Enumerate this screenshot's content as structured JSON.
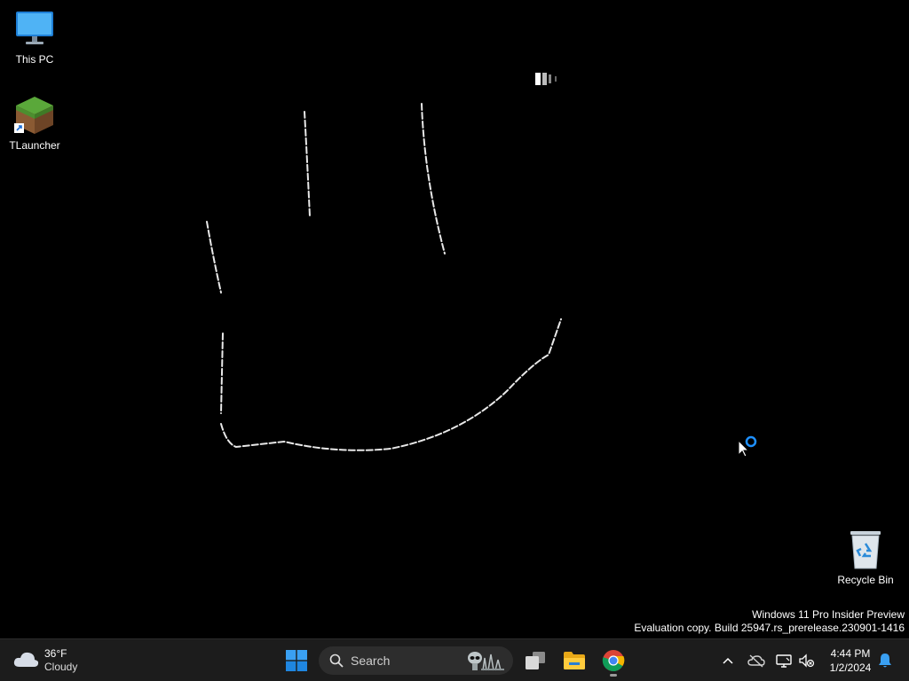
{
  "desktop": {
    "icons": [
      {
        "label": "This PC",
        "icon": "monitor-icon"
      },
      {
        "label": "TLauncher",
        "icon": "grass-block-icon"
      },
      {
        "label": "Recycle Bin",
        "icon": "recycle-bin-icon"
      }
    ],
    "watermark": {
      "line1": "Windows 11 Pro Insider Preview",
      "line2": "Evaluation copy. Build 25947.rs_prerelease.230901-1416"
    }
  },
  "taskbar": {
    "weather": {
      "temp": "36°F",
      "condition": "Cloudy"
    },
    "search": {
      "placeholder": "Search"
    },
    "pinned": [
      {
        "name": "start-button",
        "icon": "windows-logo-icon"
      },
      {
        "name": "task-view-button",
        "icon": "task-view-icon"
      },
      {
        "name": "file-explorer-button",
        "icon": "folder-icon"
      },
      {
        "name": "chrome-button",
        "icon": "chrome-icon"
      }
    ],
    "tray": {
      "time": "4:44 PM",
      "date": "1/2/2024"
    }
  },
  "colors": {
    "taskbar_bg": "#1c1c1c",
    "accent": "#0078d4",
    "loading_ring": "#1e90ff"
  }
}
